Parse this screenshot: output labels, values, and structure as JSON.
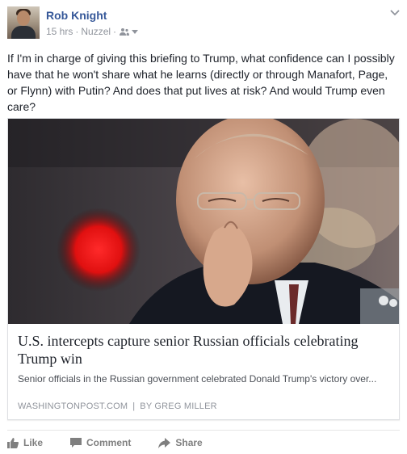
{
  "post": {
    "author": "Rob Knight",
    "timestamp": "15 hrs",
    "separator": "·",
    "source_app": "Nuzzel",
    "privacy_icon": "friends-icon",
    "text": "If I'm in charge of giving this briefing to Trump, what confidence can I possibly have that he won't share what he learns (directly or through Manafort, Page, or Flynn) with Putin? And does that put lives at risk? And would Trump even care?"
  },
  "link_card": {
    "title": "U.S. intercepts capture senior Russian officials celebrating Trump win",
    "description": "Senior officials in the Russian government celebrated Donald Trump's victory over...",
    "domain": "WASHINGTONPOST.COM",
    "source_separator": "|",
    "byline": "BY GREG MILLER"
  },
  "actions": {
    "like": "Like",
    "comment": "Comment",
    "share": "Share"
  },
  "colors": {
    "author_link": "#365899",
    "meta_gray": "#90949c",
    "action_gray": "#7f7f7f"
  }
}
